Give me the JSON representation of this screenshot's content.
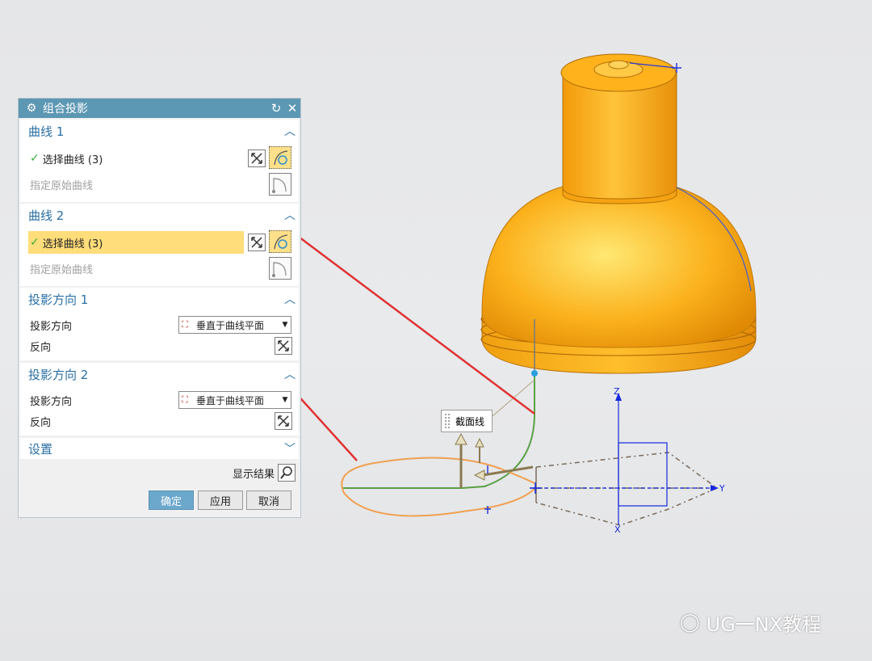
{
  "dialog": {
    "title": "组合投影",
    "curve1": {
      "title": "曲线 1",
      "select_label": "选择曲线 (3)",
      "origin_label": "指定原始曲线"
    },
    "curve2": {
      "title": "曲线 2",
      "select_label": "选择曲线 (3)",
      "origin_label": "指定原始曲线"
    },
    "proj1": {
      "title": "投影方向 1",
      "dir_label": "投影方向",
      "dir_value": "垂直于曲线平面",
      "reverse_label": "反向"
    },
    "proj2": {
      "title": "投影方向 2",
      "dir_label": "投影方向",
      "dir_value": "垂直于曲线平面",
      "reverse_label": "反向"
    },
    "settings": {
      "title": "设置"
    },
    "preview_label": "显示结果",
    "buttons": {
      "ok": "确定",
      "apply": "应用",
      "cancel": "取消"
    }
  },
  "viewport": {
    "section_tag": "截面线",
    "axes": {
      "z": "Z",
      "y": "Y",
      "x": "X"
    }
  },
  "watermark": "UG一NX教程",
  "colors": {
    "titlebar": "#5c97b3",
    "group_title": "#2a6fa3",
    "highlight": "#ffdd7a",
    "part": "#f5a718",
    "curve_orange": "#f0a050",
    "curve_green": "#5aa046",
    "arrow_red": "#e03232",
    "csys_blue": "#1428dc"
  }
}
